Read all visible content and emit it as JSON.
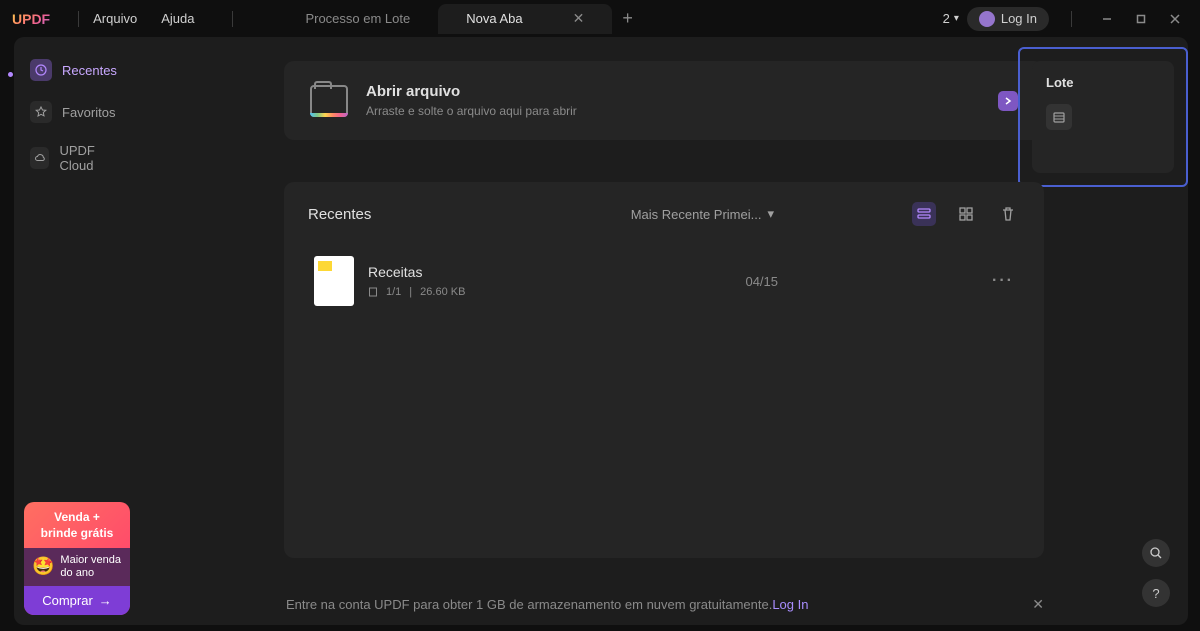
{
  "logo": "UPDF",
  "menu": {
    "file": "Arquivo",
    "help": "Ajuda"
  },
  "tabs": {
    "batch": "Processo em Lote",
    "newtab": "Nova Aba"
  },
  "topright": {
    "number": "2",
    "login": "Log In"
  },
  "sidebar": {
    "recentes": "Recentes",
    "favoritos": "Favoritos",
    "cloud": "UPDF Cloud"
  },
  "promo": {
    "line1": "Venda +",
    "line2": "brinde grátis",
    "mid": "Maior venda do ano",
    "btn": "Comprar"
  },
  "open": {
    "title": "Abrir arquivo",
    "sub": "Arraste e solte o arquivo aqui para abrir"
  },
  "lote": {
    "title": "Lote"
  },
  "recents": {
    "title": "Recentes",
    "sort": "Mais Recente Primei..."
  },
  "file": {
    "name": "Receitas",
    "pages": "1/1",
    "size": "26.60 KB",
    "date": "04/15"
  },
  "notice": {
    "text": "Entre na conta UPDF para obter 1 GB de armazenamento em nuvem gratuitamente.",
    "link": "Log In"
  }
}
